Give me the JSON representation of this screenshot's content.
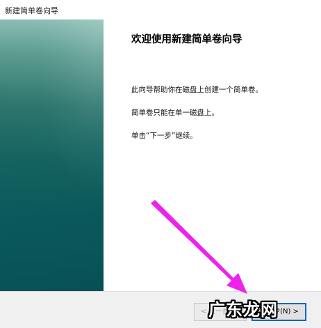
{
  "window": {
    "title": "新建简单卷向导"
  },
  "page": {
    "heading": "欢迎使用新建简单卷向导",
    "paragraphs": [
      "此向导帮助你在磁盘上创建一个简单卷。",
      "简单卷只能在单一磁盘上。",
      "单击“下一步”继续。"
    ]
  },
  "buttons": {
    "back_label": "< 上一步(B)",
    "next_label": "下一步(N) >"
  },
  "overlay": {
    "arrow_color": "#ee22ee",
    "watermark_text": "广东龙网"
  },
  "colors": {
    "banner_top": "#8cc0b6",
    "banner_bottom": "#075257",
    "focus_border": "#0a66c2"
  }
}
